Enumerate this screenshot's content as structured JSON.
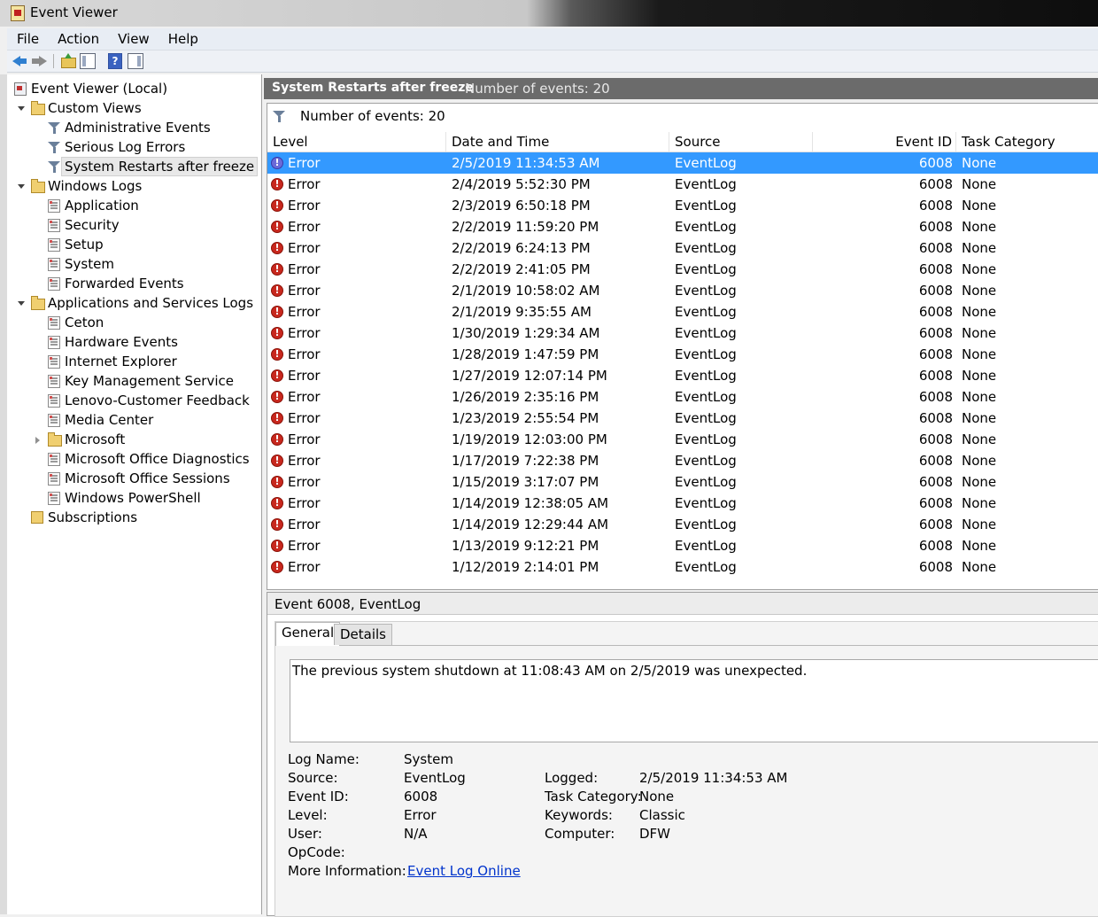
{
  "window": {
    "title": "Event Viewer"
  },
  "menu": [
    "File",
    "Action",
    "View",
    "Help"
  ],
  "tree": {
    "root": "Event Viewer (Local)",
    "custom_views": "Custom Views",
    "custom_items": [
      "Administrative Events",
      "Serious Log Errors",
      "System Restarts after freeze"
    ],
    "windows_logs": "Windows Logs",
    "windows_items": [
      "Application",
      "Security",
      "Setup",
      "System",
      "Forwarded Events"
    ],
    "apps_services": "Applications and Services Logs",
    "apps_items": [
      "Ceton",
      "Hardware Events",
      "Internet Explorer",
      "Key Management Service",
      "Lenovo-Customer Feedback",
      "Media Center",
      "Microsoft",
      "Microsoft Office Diagnostics",
      "Microsoft Office Sessions",
      "Windows PowerShell"
    ],
    "subscriptions": "Subscriptions"
  },
  "header": {
    "title": "System Restarts after freeze",
    "count": "Number of events: 20"
  },
  "filter": {
    "text": "Number of events: 20"
  },
  "columns": [
    "Level",
    "Date and Time",
    "Source",
    "Event ID",
    "Task Category"
  ],
  "events": [
    {
      "level": "Error",
      "date": "2/5/2019 11:34:53 AM",
      "source": "EventLog",
      "id": "6008",
      "cat": "None"
    },
    {
      "level": "Error",
      "date": "2/4/2019 5:52:30 PM",
      "source": "EventLog",
      "id": "6008",
      "cat": "None"
    },
    {
      "level": "Error",
      "date": "2/3/2019 6:50:18 PM",
      "source": "EventLog",
      "id": "6008",
      "cat": "None"
    },
    {
      "level": "Error",
      "date": "2/2/2019 11:59:20 PM",
      "source": "EventLog",
      "id": "6008",
      "cat": "None"
    },
    {
      "level": "Error",
      "date": "2/2/2019 6:24:13 PM",
      "source": "EventLog",
      "id": "6008",
      "cat": "None"
    },
    {
      "level": "Error",
      "date": "2/2/2019 2:41:05 PM",
      "source": "EventLog",
      "id": "6008",
      "cat": "None"
    },
    {
      "level": "Error",
      "date": "2/1/2019 10:58:02 AM",
      "source": "EventLog",
      "id": "6008",
      "cat": "None"
    },
    {
      "level": "Error",
      "date": "2/1/2019 9:35:55 AM",
      "source": "EventLog",
      "id": "6008",
      "cat": "None"
    },
    {
      "level": "Error",
      "date": "1/30/2019 1:29:34 AM",
      "source": "EventLog",
      "id": "6008",
      "cat": "None"
    },
    {
      "level": "Error",
      "date": "1/28/2019 1:47:59 PM",
      "source": "EventLog",
      "id": "6008",
      "cat": "None"
    },
    {
      "level": "Error",
      "date": "1/27/2019 12:07:14 PM",
      "source": "EventLog",
      "id": "6008",
      "cat": "None"
    },
    {
      "level": "Error",
      "date": "1/26/2019 2:35:16 PM",
      "source": "EventLog",
      "id": "6008",
      "cat": "None"
    },
    {
      "level": "Error",
      "date": "1/23/2019 2:55:54 PM",
      "source": "EventLog",
      "id": "6008",
      "cat": "None"
    },
    {
      "level": "Error",
      "date": "1/19/2019 12:03:00 PM",
      "source": "EventLog",
      "id": "6008",
      "cat": "None"
    },
    {
      "level": "Error",
      "date": "1/17/2019 7:22:38 PM",
      "source": "EventLog",
      "id": "6008",
      "cat": "None"
    },
    {
      "level": "Error",
      "date": "1/15/2019 3:17:07 PM",
      "source": "EventLog",
      "id": "6008",
      "cat": "None"
    },
    {
      "level": "Error",
      "date": "1/14/2019 12:38:05 AM",
      "source": "EventLog",
      "id": "6008",
      "cat": "None"
    },
    {
      "level": "Error",
      "date": "1/14/2019 12:29:44 AM",
      "source": "EventLog",
      "id": "6008",
      "cat": "None"
    },
    {
      "level": "Error",
      "date": "1/13/2019 9:12:21 PM",
      "source": "EventLog",
      "id": "6008",
      "cat": "None"
    },
    {
      "level": "Error",
      "date": "1/12/2019 2:14:01 PM",
      "source": "EventLog",
      "id": "6008",
      "cat": "None"
    }
  ],
  "detail": {
    "title": "Event 6008, EventLog",
    "tabs": [
      "General",
      "Details"
    ],
    "message": "The previous system shutdown at 11:08:43 AM on 2/5/2019 was unexpected.",
    "labels": {
      "log_name": "Log Name:",
      "source": "Source:",
      "event_id": "Event ID:",
      "level": "Level:",
      "user": "User:",
      "opcode": "OpCode:",
      "more_info": "More Information:",
      "logged": "Logged:",
      "task_category": "Task Category:",
      "keywords": "Keywords:",
      "computer": "Computer:"
    },
    "values": {
      "log_name": "System",
      "source": "EventLog",
      "event_id": "6008",
      "level": "Error",
      "user": "N/A",
      "opcode": "",
      "more_info": "Event Log Online",
      "logged": "2/5/2019 11:34:53 AM",
      "task_category": "None",
      "keywords": "Classic",
      "computer": "DFW"
    }
  },
  "colors": {
    "selection": "#3399ff",
    "header_bg": "#6b6b6b",
    "error": "#c8281e"
  }
}
